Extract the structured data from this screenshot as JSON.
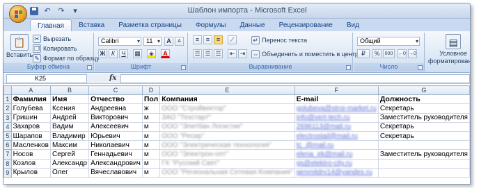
{
  "window": {
    "title": "Шаблон импорта - Microsoft Excel"
  },
  "tabs": [
    "Главная",
    "Вставка",
    "Разметка страницы",
    "Формулы",
    "Данные",
    "Рецензирование",
    "Вид"
  ],
  "ribbon": {
    "clipboard": {
      "paste": "Вставить",
      "cut": "Вырезать",
      "copy": "Копировать",
      "format_painter": "Формат по образцу",
      "label": "Буфер обмена"
    },
    "font": {
      "font_name": "Calibri",
      "font_size": "11",
      "bold": "Ж",
      "italic": "К",
      "underline": "Ч",
      "grow": "A",
      "shrink": "A",
      "color": "A",
      "label": "Шрифт"
    },
    "alignment": {
      "wrap_text": "Перенос текста",
      "merge_center": "Объединить и поместить в центре",
      "label": "Выравнивание"
    },
    "number": {
      "format": "Общий",
      "percent": "%",
      "thousands": "000",
      "label": "Число"
    },
    "styles": {
      "conditional_formatting_1": "Условное",
      "conditional_formatting_2": "форматирование"
    }
  },
  "formula_bar": {
    "name_box": "K25",
    "fx": "fx",
    "formula": ""
  },
  "sheet": {
    "columns": [
      "A",
      "B",
      "C",
      "D",
      "E",
      "F",
      "G"
    ],
    "rows": [
      {
        "n": "1",
        "cells": [
          "Фамилия",
          "Имя",
          "Отчество",
          "Пол",
          "Компания",
          "E-mail",
          "Должность"
        ]
      },
      {
        "n": "2",
        "cells": [
          "Голубева",
          "Ксения",
          "Андреевна",
          "ж",
          "ООО \"Стройвектор\"",
          "golubeva@stroi-market.ru",
          "Секретарь"
        ]
      },
      {
        "n": "3",
        "cells": [
          "Гришин",
          "Андрей",
          "Викторович",
          "м",
          "ЗАО \"Техстарт\"",
          "info@vert-tech.ru",
          "Заместитель руководителя"
        ]
      },
      {
        "n": "4",
        "cells": [
          "Захаров",
          "Вадим",
          "Алексеевич",
          "м",
          "ООО \"Элитбан Логистик\"",
          "2696113@mail.ru",
          "Секретарь"
        ]
      },
      {
        "n": "5",
        "cells": [
          "Шарапов",
          "Владимир",
          "Юрьевич",
          "м",
          "ООО \"Ресир\"",
          "electrostail@mail.ru",
          "Секретарь"
        ]
      },
      {
        "n": "6",
        "cells": [
          "Масленков",
          "Максим",
          "Николаевич",
          "м",
          "ООО \"Электрическая технология\"",
          "tc_@mail.ru",
          ""
        ]
      },
      {
        "n": "7",
        "cells": [
          "Носов",
          "Сергей",
          "Геннадьевич",
          "м",
          "ООО \"Электрон-опт\"",
          "elena_ek@mail.ru",
          "Заместитель руководителя"
        ]
      },
      {
        "n": "8",
        "cells": [
          "Козлов",
          "Александр",
          "Александрович",
          "м",
          "ГК \"Русский Свет\"",
          "gs@elektro-city.ru",
          ""
        ]
      },
      {
        "n": "9",
        "cells": [
          "Крылов",
          "Олег",
          "Вячеславович",
          "м",
          "ООО \"Региональная Сетевая Компания\"",
          "genmitdrv14@yandex.ru",
          ""
        ]
      }
    ]
  }
}
